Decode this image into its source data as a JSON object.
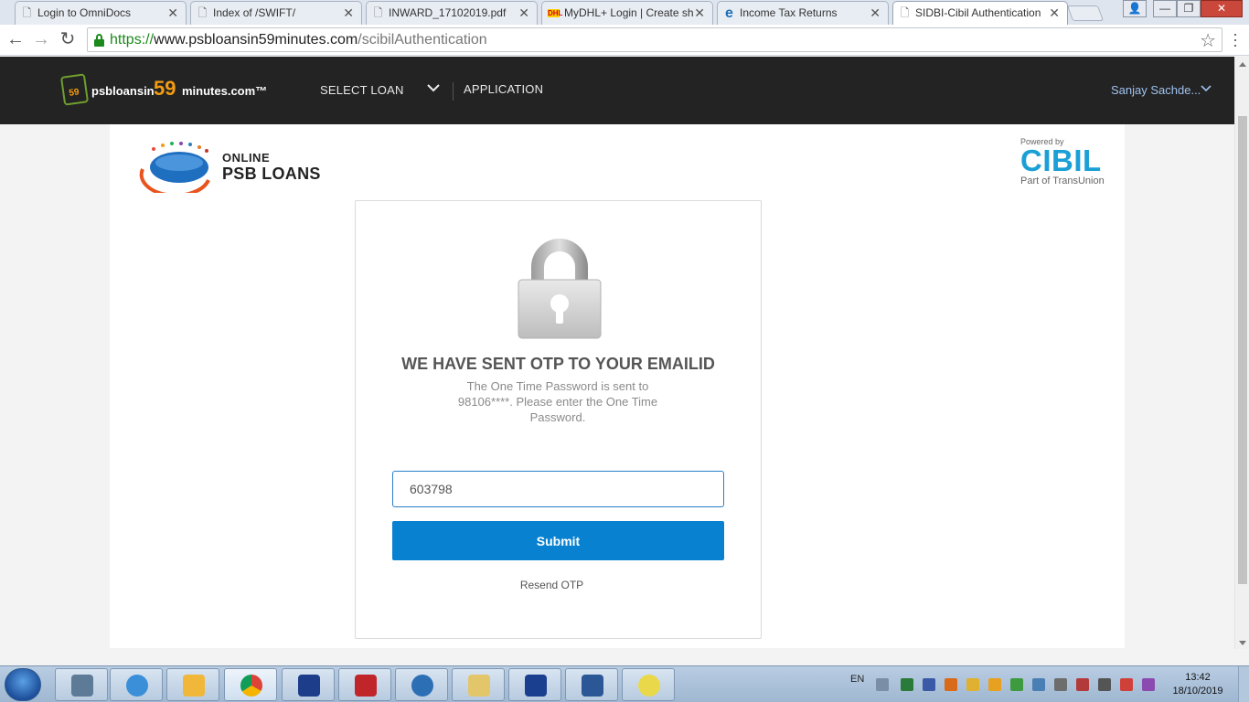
{
  "browser": {
    "tabs": [
      {
        "title": "Login to OmniDocs",
        "icon": "page-icon"
      },
      {
        "title": "Index of /SWIFT/",
        "icon": "page-icon"
      },
      {
        "title": "INWARD_17102019.pdf",
        "icon": "page-icon"
      },
      {
        "title": "MyDHL+ Login | Create sh",
        "icon": "dhl-icon"
      },
      {
        "title": "Income Tax Returns",
        "icon": "ie-icon"
      },
      {
        "title": "SIDBI-Cibil Authentication",
        "icon": "page-icon",
        "active": true
      }
    ],
    "url": {
      "scheme": "https://",
      "host": "www.psbloansin59minutes.com",
      "path": "/scibilAuthentication"
    }
  },
  "site_header": {
    "logo": {
      "badge": "59",
      "part1": "psbloansin",
      "part2": "59",
      "part3": "minutes.com™"
    },
    "nav": {
      "select_loan": "SELECT LOAN",
      "application": "APPLICATION"
    },
    "user": "Sanjay Sachde..."
  },
  "brand": {
    "psb_line1": "ONLINE",
    "psb_line2": "PSB LOANS",
    "cibil_powered": "Powered by",
    "cibil_name": "CIBIL",
    "cibil_part": "Part of TransUnion"
  },
  "otp_card": {
    "heading": "WE HAVE SENT OTP TO YOUR EMAILID",
    "subtext": "The One Time Password is sent to 98106****. Please enter the One Time Password.",
    "otp_value": "603798",
    "submit_label": "Submit",
    "resend_label": "Resend OTP"
  },
  "taskbar": {
    "language": "EN",
    "time": "13:42",
    "date": "18/10/2019"
  },
  "colors": {
    "header_bg": "#232323",
    "accent_orange": "#f39c12",
    "submit_blue": "#0882d0",
    "cibil_blue": "#1a9fd6"
  }
}
